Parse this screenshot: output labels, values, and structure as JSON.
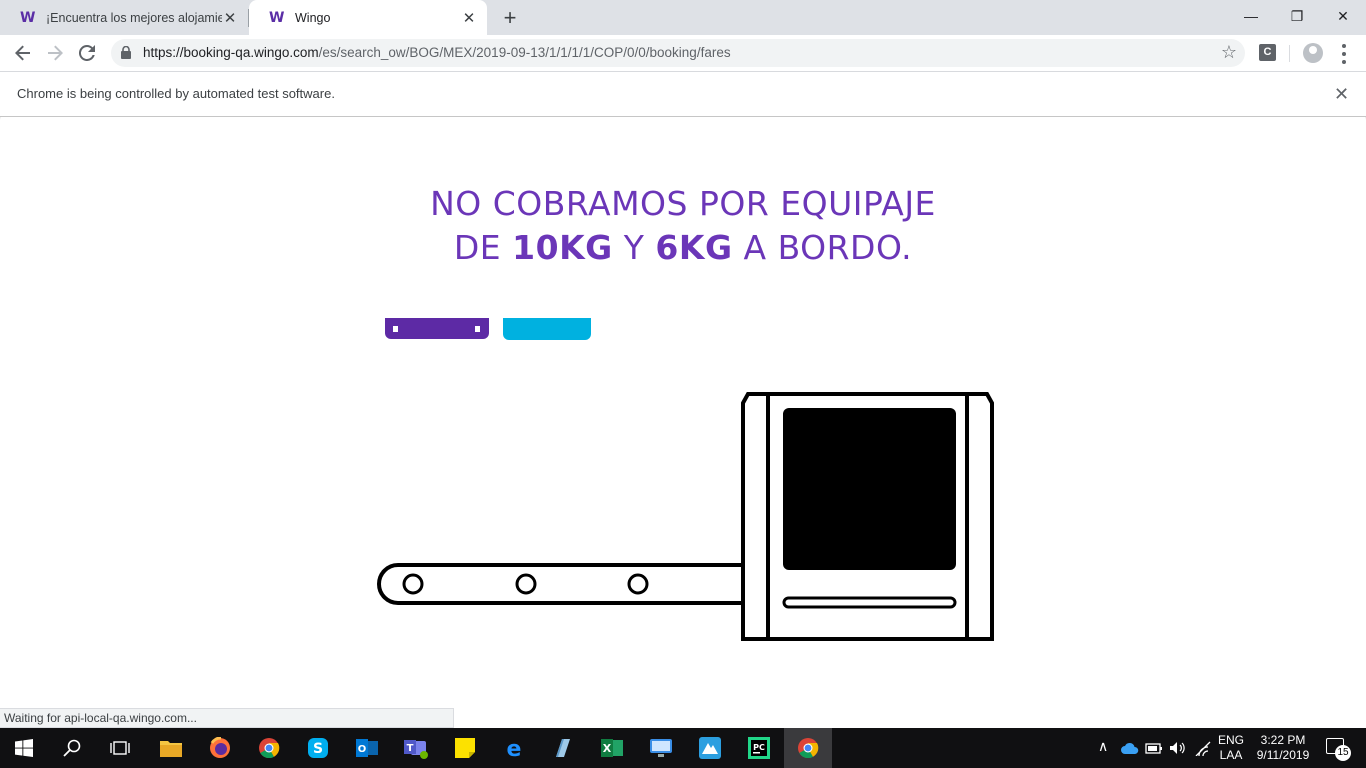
{
  "browser": {
    "tabs": [
      {
        "favicon": "W",
        "title": "¡Encuentra los mejores alojamien"
      },
      {
        "favicon": "W",
        "title": "Wingo"
      }
    ],
    "new_tab_label": "+",
    "window_controls": {
      "minimize": "—",
      "restore": "❐",
      "close": "✕"
    },
    "url_host": "https://booking-qa.wingo.com",
    "url_path": "/es/search_ow/BOG/MEX/2019-09-13/1/1/1/1/COP/0/0/booking/fares",
    "extension_label": "C",
    "infobar_message": "Chrome is being controlled by automated test software.",
    "status_text": "Waiting for api-local-qa.wingo.com..."
  },
  "page": {
    "headline_line1": "NO COBRAMOS POR EQUIPAJE",
    "headline_de": "DE",
    "headline_10kg": "10KG",
    "headline_y": "Y",
    "headline_6kg": "6KG",
    "headline_end": "A BORDO.",
    "accent_purple": "#6b36b8",
    "accent_cyan": "#00b1e0"
  },
  "taskbar": {
    "apps": [
      "windows-start",
      "search",
      "task-view",
      "file-explorer",
      "firefox",
      "chrome",
      "skype",
      "outlook",
      "teams",
      "sticky-notes",
      "edge",
      "notepad",
      "excel",
      "remote-desktop",
      "azure",
      "pycharm",
      "chrome-active"
    ],
    "lang_primary": "ENG",
    "lang_secondary": "LAA",
    "time": "3:22 PM",
    "date": "9/11/2019",
    "notification_count": "15"
  }
}
